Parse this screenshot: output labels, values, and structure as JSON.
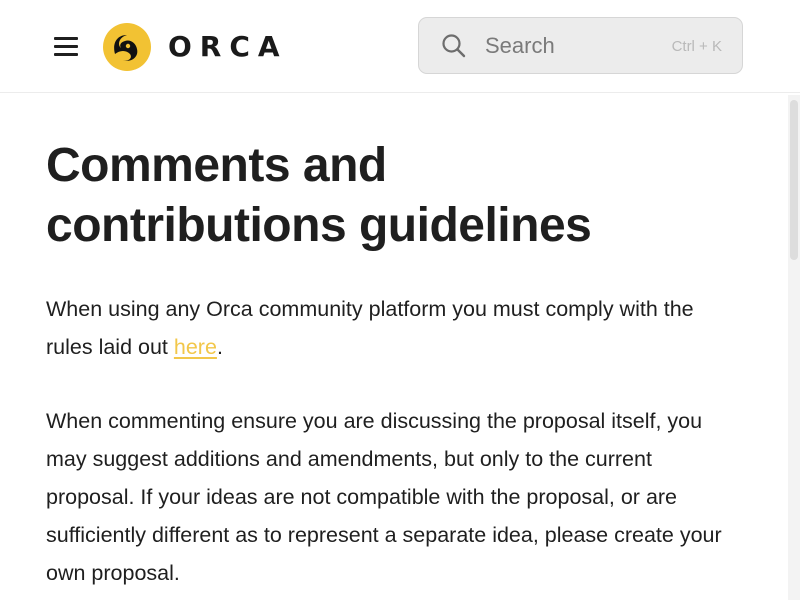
{
  "header": {
    "brand_name": "ORCA",
    "search": {
      "placeholder": "Search",
      "shortcut": "Ctrl + K"
    }
  },
  "icons": {
    "menu": "hamburger-menu-icon",
    "logo": "orca-logo-icon",
    "search": "magnifier-icon"
  },
  "colors": {
    "brand_yellow": "#f2c233",
    "link": "#f2c74a",
    "text": "#1f1f1f",
    "search_bg": "#ececec"
  },
  "article": {
    "title_line1": "Comments and",
    "title_line2": "contributions guidelines",
    "para1_before": "When using any Orca community platform you must comply with the rules laid out ",
    "para1_link": "here",
    "para1_after": ".",
    "para2": "When commenting ensure you are discussing the proposal itself, you may suggest additions and amendments, but only to the current proposal. If your ideas are not compatible with the proposal, or are sufficiently different as to represent a separate idea, please create your own proposal."
  }
}
